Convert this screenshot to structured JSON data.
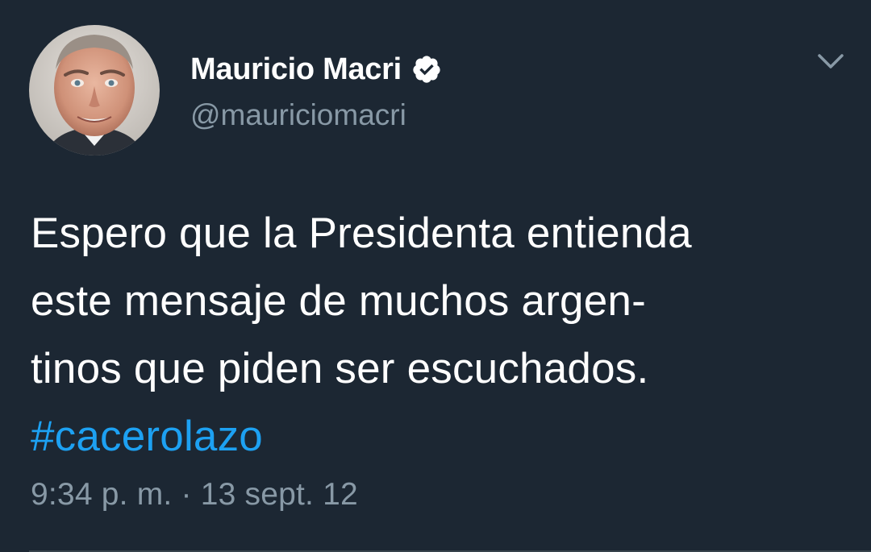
{
  "author": {
    "display_name": "Mauricio Macri",
    "handle": "@mauriciomacri",
    "verified": true
  },
  "tweet": {
    "lines": [
      "Espero que la Presidenta entienda",
      "este mensaje de muchos argen-",
      "tinos que piden ser escuchados."
    ],
    "hashtag": "#cacerolazo",
    "time": "9:34 p. m.",
    "separator": "·",
    "date": "13 sept. 12"
  },
  "icons": {
    "verified": "verified-badge-icon",
    "menu": "chevron-down-icon"
  },
  "colors": {
    "background": "#1c2733",
    "text": "#ffffff",
    "secondary": "#8899a6",
    "link": "#1da1f2"
  }
}
